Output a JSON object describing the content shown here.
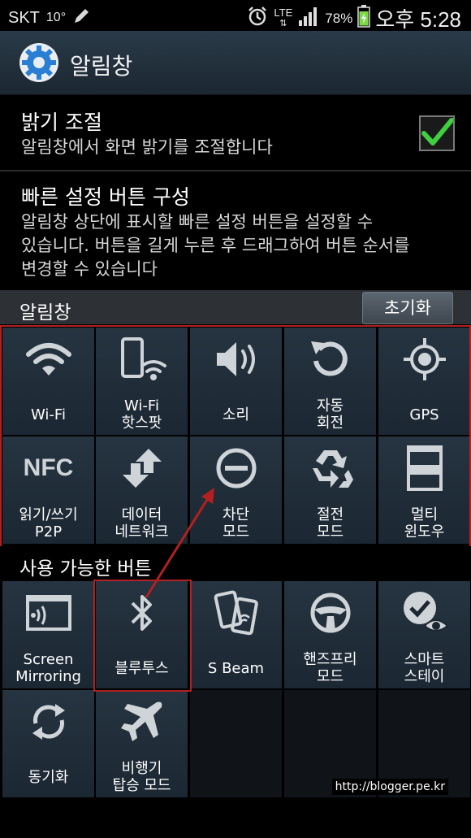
{
  "status_bar": {
    "carrier": "SKT",
    "temperature": "10°",
    "network": "LTE",
    "battery_percent": "78%",
    "time": "오후 5:28"
  },
  "action_bar": {
    "title": "알림창",
    "icon": "gear-icon"
  },
  "brightness_setting": {
    "title": "밝기 조절",
    "description": "알림창에서 화면 밝기를 조절합니다",
    "checked": true
  },
  "quick_settings": {
    "title": "빠른 설정 버튼 구성",
    "description_lines": [
      "알림창 상단에 표시할 빠른 설정 버튼을 설정할 수",
      "있습니다. 버튼을 길게 누른 후 드래그하여 버튼 순서를",
      "변경할 수 있습니다"
    ]
  },
  "notification_panel": {
    "header": "알림창",
    "reset_label": "초기화",
    "tiles": [
      {
        "label": "Wi-Fi",
        "icon": "wifi-icon"
      },
      {
        "label": "Wi-Fi\n핫스팟",
        "icon": "hotspot-icon"
      },
      {
        "label": "소리",
        "icon": "speaker-icon"
      },
      {
        "label": "자동\n회전",
        "icon": "rotate-icon"
      },
      {
        "label": "GPS",
        "icon": "gps-icon"
      },
      {
        "label": "읽기/쓰기\nP2P",
        "icon": "nfc-icon",
        "icon_text": "NFC"
      },
      {
        "label": "데이터\n네트워크",
        "icon": "data-network-icon"
      },
      {
        "label": "차단\n모드",
        "icon": "block-mode-icon"
      },
      {
        "label": "절전\n모드",
        "icon": "power-saving-icon"
      },
      {
        "label": "멀티\n윈도우",
        "icon": "multi-window-icon"
      }
    ]
  },
  "available_buttons": {
    "header": "사용 가능한 버튼",
    "tiles": [
      {
        "label": "Screen\nMirroring",
        "icon": "screen-mirroring-icon"
      },
      {
        "label": "블루투스",
        "icon": "bluetooth-icon"
      },
      {
        "label": "S Beam",
        "icon": "s-beam-icon"
      },
      {
        "label": "핸즈프리\n모드",
        "icon": "steering-wheel-icon"
      },
      {
        "label": "스마트\n스테이",
        "icon": "smart-stay-icon"
      },
      {
        "label": "동기화",
        "icon": "sync-icon"
      },
      {
        "label": "비행기\n탑승 모드",
        "icon": "airplane-icon"
      }
    ]
  },
  "watermark": "http://blogger.pe.kr",
  "colors": {
    "highlight": "#b32020",
    "check": "#3fcf3f",
    "battery": "#7dd84a"
  }
}
